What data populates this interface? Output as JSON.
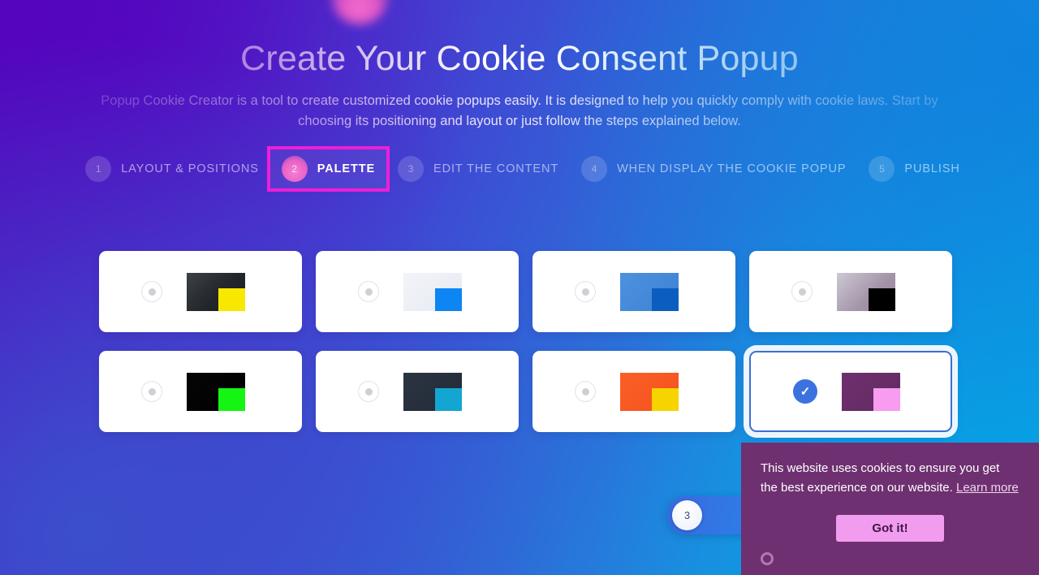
{
  "header": {
    "title": "Create Your Cookie Consent Popup",
    "subtitle": "Popup Cookie Creator is a tool to create customized cookie popups easily. It is designed to help you quickly comply with cookie laws. Start by choosing its positioning and layout or just follow the steps explained below."
  },
  "steps": [
    {
      "number": "1",
      "label": "LAYOUT & POSITIONS",
      "active": false
    },
    {
      "number": "2",
      "label": "PALETTE",
      "active": true
    },
    {
      "number": "3",
      "label": "EDIT THE CONTENT",
      "active": false
    },
    {
      "number": "4",
      "label": "WHEN DISPLAY THE COOKIE POPUP",
      "active": false
    },
    {
      "number": "5",
      "label": "PUBLISH",
      "active": false
    }
  ],
  "palettes": [
    {
      "name": "palette-dark-yellow",
      "base": "linear-gradient(135deg,#3c4145 0%,#22262a 55%,#1d2125 100%)",
      "accent": "#f8e800",
      "selected": false
    },
    {
      "name": "palette-light-blue",
      "base": "linear-gradient(135deg,#f2f4f9 0%,#e7eaf2 100%)",
      "accent": "#0d85f2",
      "selected": false
    },
    {
      "name": "palette-blue-navy",
      "base": "linear-gradient(135deg,#4d92dd 0%,#3c82d4 100%)",
      "accent": "#0b5ec0",
      "selected": false
    },
    {
      "name": "palette-mauve-black",
      "base": "linear-gradient(135deg,#cdc9d2 0%,#a293a8 60%,#9a8aa2 100%)",
      "accent": "#000000",
      "selected": false
    },
    {
      "name": "palette-black-green",
      "base": "linear-gradient(135deg,#050505 0%,#000000 100%)",
      "accent": "#14f514",
      "selected": false
    },
    {
      "name": "palette-navy-cyan",
      "base": "linear-gradient(135deg,#2b3441 0%,#222b36 100%)",
      "accent": "#14a6d2",
      "selected": false
    },
    {
      "name": "palette-orange-yellow",
      "base": "linear-gradient(135deg,#fa5f26 0%,#f5521f 100%)",
      "accent": "#f5d400",
      "selected": false
    },
    {
      "name": "palette-purple-pink",
      "base": "linear-gradient(135deg,#6e3070 0%,#63295f 100%)",
      "accent": "#f79cf0",
      "selected": true
    }
  ],
  "slider": {
    "value": "3"
  },
  "cookie_popup": {
    "message": "This website uses cookies to ensure you get the best experience on our website.",
    "link_label": "Learn more",
    "button_label": "Got it!"
  },
  "colors": {
    "highlight": "#ee1fd6",
    "accent_blue": "#3b72e0",
    "popup_bg": "#6e3070",
    "popup_button": "#f29cf0"
  }
}
